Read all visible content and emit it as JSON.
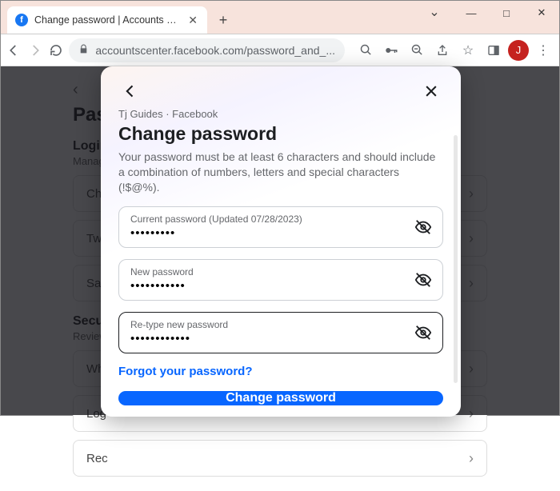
{
  "browser": {
    "tab_title": "Change password | Accounts Cen",
    "url": "accountscenter.facebook.com/password_and_...",
    "avatar_letter": "J",
    "winbtns": {
      "min": "—",
      "max": "□",
      "close": "✕"
    }
  },
  "bgpage": {
    "title": "Pass",
    "login_label": "Login",
    "login_sub": "Manage",
    "rows": [
      "Cha",
      "Two",
      "Sav"
    ],
    "sec_label": "Secur",
    "sec_sub": "Review",
    "sec_rows": [
      "Whe",
      "Log",
      "Rec"
    ]
  },
  "modal": {
    "breadcrumb": "Tj Guides · Facebook",
    "title": "Change password",
    "description": "Your password must be at least 6 characters and should include a combination of numbers, letters and special characters (!$@%).",
    "fields": {
      "current": {
        "label": "Current password (Updated 07/28/2023)",
        "value": "•••••••••"
      },
      "new": {
        "label": "New password",
        "value": "•••••••••••"
      },
      "retype": {
        "label": "Re-type new password",
        "value": "••••••••••••"
      }
    },
    "forgot": "Forgot your password?",
    "submit": "Change password"
  }
}
